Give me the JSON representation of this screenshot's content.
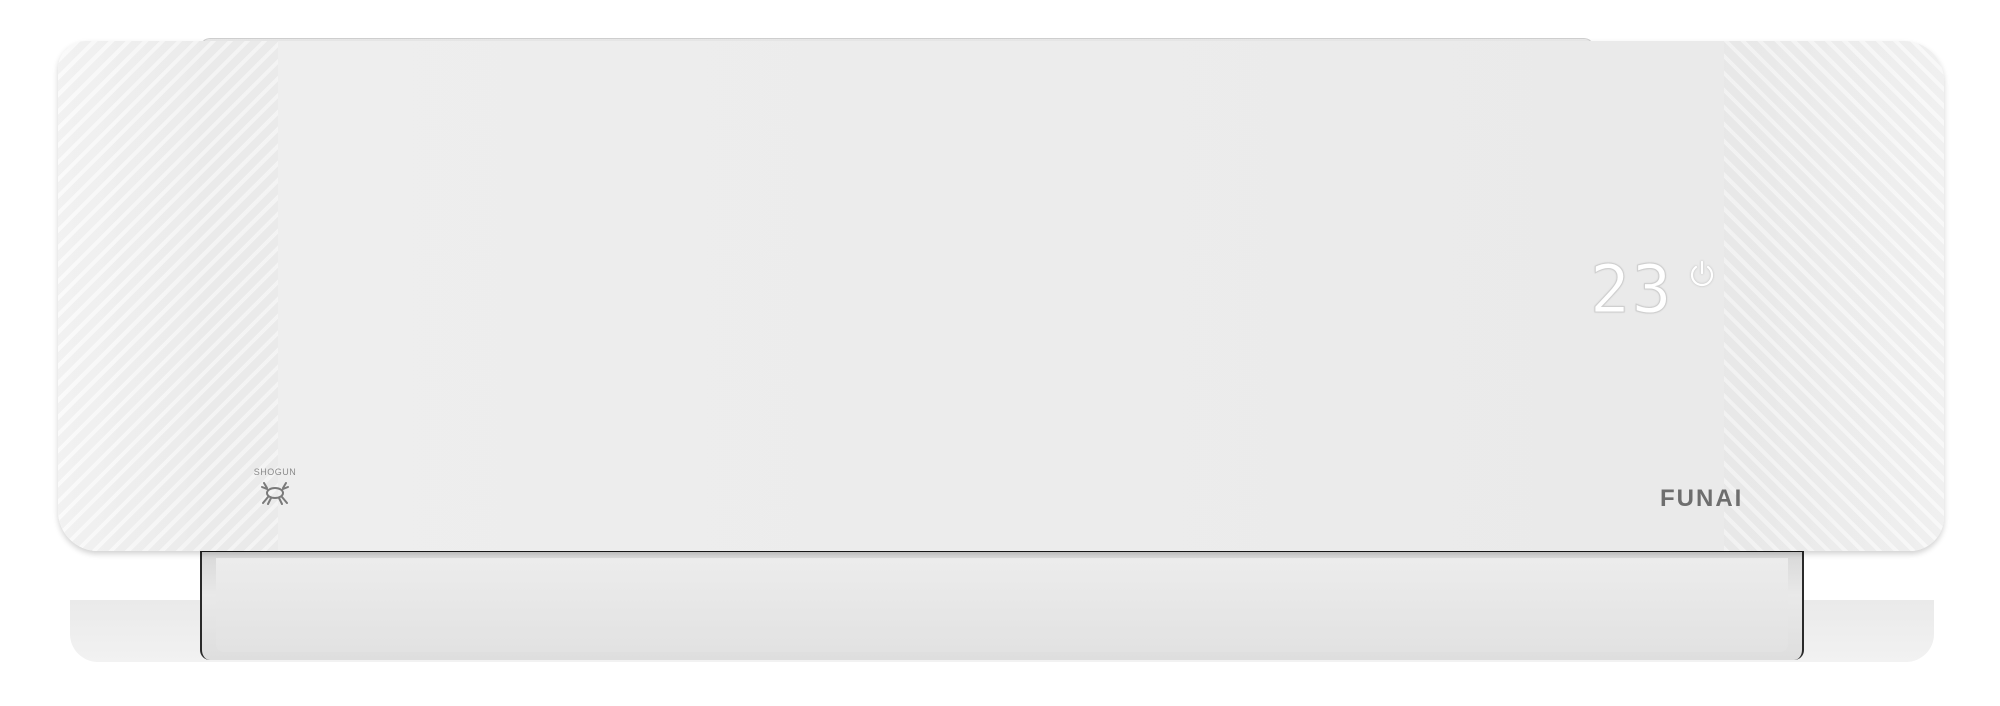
{
  "product": {
    "brand_text": "FUNAI",
    "sub_brand_text": "SHOGUN"
  },
  "display": {
    "temperature": "23",
    "power_icon": "power-icon"
  },
  "colors": {
    "unit_body": "#eeeeee",
    "display_digits": "#ffffff",
    "brand_text": "#6e6e6e",
    "louver_edge": "#2a2a2a"
  }
}
